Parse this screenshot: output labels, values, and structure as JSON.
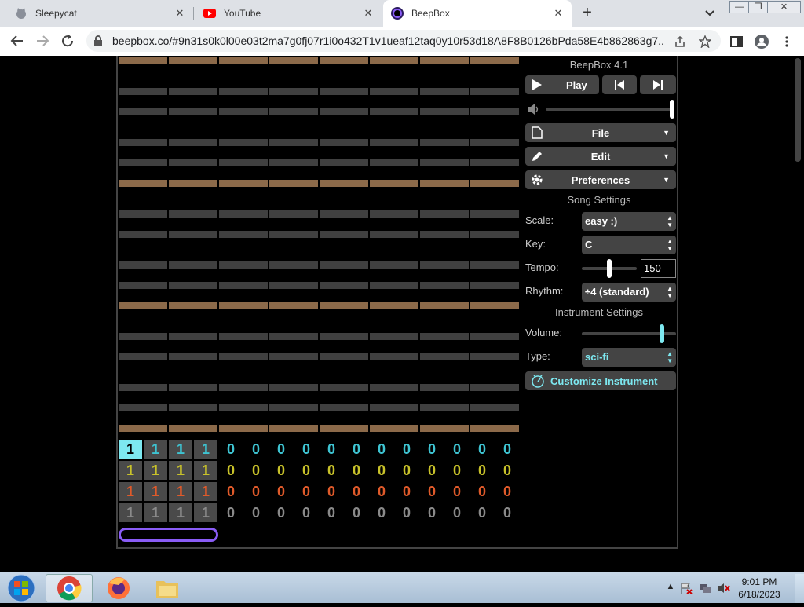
{
  "browser": {
    "tabs": [
      {
        "title": "Sleepycat",
        "icon": "cat-icon"
      },
      {
        "title": "YouTube",
        "icon": "youtube-icon"
      },
      {
        "title": "BeepBox",
        "icon": "beepbox-icon"
      }
    ],
    "active_tab": 2,
    "url": "beepbox.co/#9n31s0k0l00e03t2ma7g0fj07r1i0o432T1v1ueaf12taq0y10r53d18A8F8B0126bPda58E4b862863g7..."
  },
  "app": {
    "title": "BeepBox 4.1",
    "play_label": "Play",
    "file_label": "File",
    "edit_label": "Edit",
    "preferences_label": "Preferences",
    "song_settings_title": "Song Settings",
    "scale_label": "Scale:",
    "scale_value": "easy :)",
    "key_label": "Key:",
    "key_value": "C",
    "tempo_label": "Tempo:",
    "tempo_value": "150",
    "rhythm_label": "Rhythm:",
    "rhythm_value": "÷4 (standard)",
    "instrument_settings_title": "Instrument Settings",
    "volume_label": "Volume:",
    "type_label": "Type:",
    "type_value": "sci-fi",
    "customize_label": "Customize Instrument",
    "master_volume": 1.0,
    "tempo_slider": 0.5,
    "instrument_volume": 1.0,
    "pattern_rows": [
      {
        "color": "#3ec4d2",
        "values": [
          "1",
          "1",
          "1",
          "1",
          "0",
          "0",
          "0",
          "0",
          "0",
          "0",
          "0",
          "0",
          "0",
          "0",
          "0",
          "0"
        ],
        "used": 4,
        "selected": 0
      },
      {
        "color": "#c9c32a",
        "values": [
          "1",
          "1",
          "1",
          "1",
          "0",
          "0",
          "0",
          "0",
          "0",
          "0",
          "0",
          "0",
          "0",
          "0",
          "0",
          "0"
        ],
        "used": 4
      },
      {
        "color": "#e05a2a",
        "values": [
          "1",
          "1",
          "1",
          "1",
          "0",
          "0",
          "0",
          "0",
          "0",
          "0",
          "0",
          "0",
          "0",
          "0",
          "0",
          "0"
        ],
        "used": 4
      },
      {
        "color": "#8a8a8a",
        "values": [
          "1",
          "1",
          "1",
          "1",
          "0",
          "0",
          "0",
          "0",
          "0",
          "0",
          "0",
          "0",
          "0",
          "0",
          "0",
          "0"
        ],
        "used": 4
      }
    ]
  },
  "taskbar": {
    "time": "9:01 PM",
    "date": "6/18/2023"
  },
  "colors": {
    "tonic": "#8c6a4a",
    "scale_note": "#404040",
    "accent": "#7de8f0",
    "selection": "#8a5cf6"
  }
}
